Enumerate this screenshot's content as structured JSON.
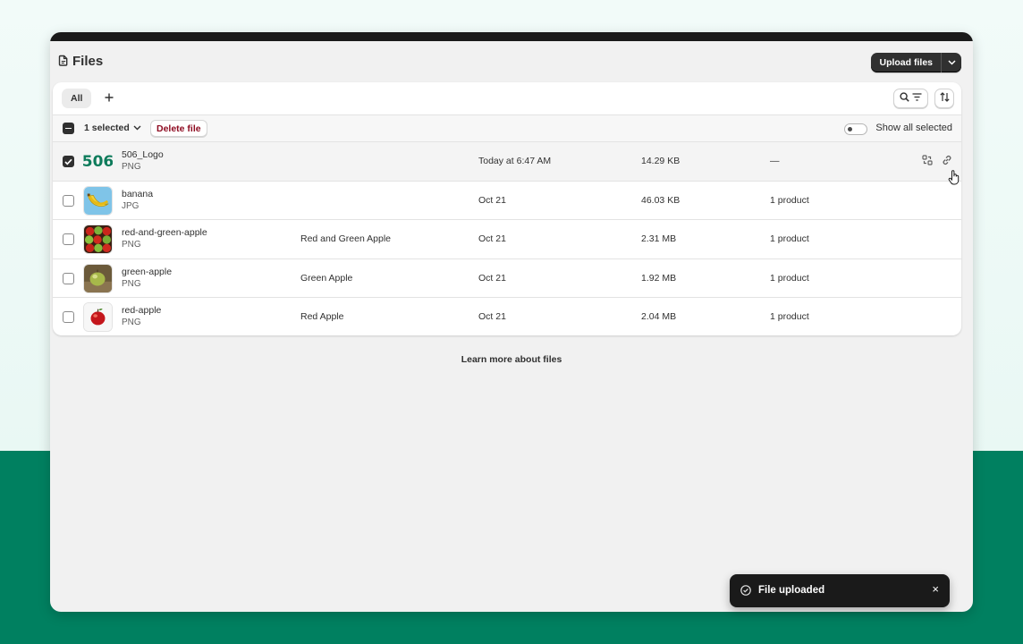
{
  "page": {
    "title": "Files"
  },
  "header": {
    "upload_label": "Upload files"
  },
  "tabs": {
    "all_label": "All",
    "add_label": "+"
  },
  "bulk": {
    "selected_label": "1 selected",
    "delete_label": "Delete file",
    "toggle_label": "Show all selected"
  },
  "files": [
    {
      "name": "506_Logo",
      "type": "PNG",
      "alt": "",
      "date": "Today at 6:47 AM",
      "size": "14.29 KB",
      "references": "—",
      "selected": true,
      "thumb": "506"
    },
    {
      "name": "banana",
      "type": "JPG",
      "alt": "",
      "date": "Oct 21",
      "size": "46.03 KB",
      "references": "1 product",
      "selected": false,
      "thumb": "banana"
    },
    {
      "name": "red-and-green-apple",
      "type": "PNG",
      "alt": "Red and Green Apple",
      "date": "Oct 21",
      "size": "2.31 MB",
      "references": "1 product",
      "selected": false,
      "thumb": "mixed-apples"
    },
    {
      "name": "green-apple",
      "type": "PNG",
      "alt": "Green Apple",
      "date": "Oct 21",
      "size": "1.92 MB",
      "references": "1 product",
      "selected": false,
      "thumb": "green-apple"
    },
    {
      "name": "red-apple",
      "type": "PNG",
      "alt": "Red Apple",
      "date": "Oct 21",
      "size": "2.04 MB",
      "references": "1 product",
      "selected": false,
      "thumb": "red-apple"
    }
  ],
  "footer": {
    "learn_more": "Learn more about files"
  },
  "toast": {
    "message": "File uploaded",
    "close": "×"
  },
  "icons": {
    "page_title": "file-icon",
    "upload_caret": "chevron-down-icon",
    "search": "search-icon",
    "filter": "filter-icon",
    "sort": "sort-icon",
    "row_action_1": "replace-icon",
    "row_action_2": "link-icon",
    "toast": "check-circle-icon"
  },
  "colors": {
    "brand_green": "#008060",
    "delete_text": "#8e0b21",
    "primary_button": "#303030"
  }
}
